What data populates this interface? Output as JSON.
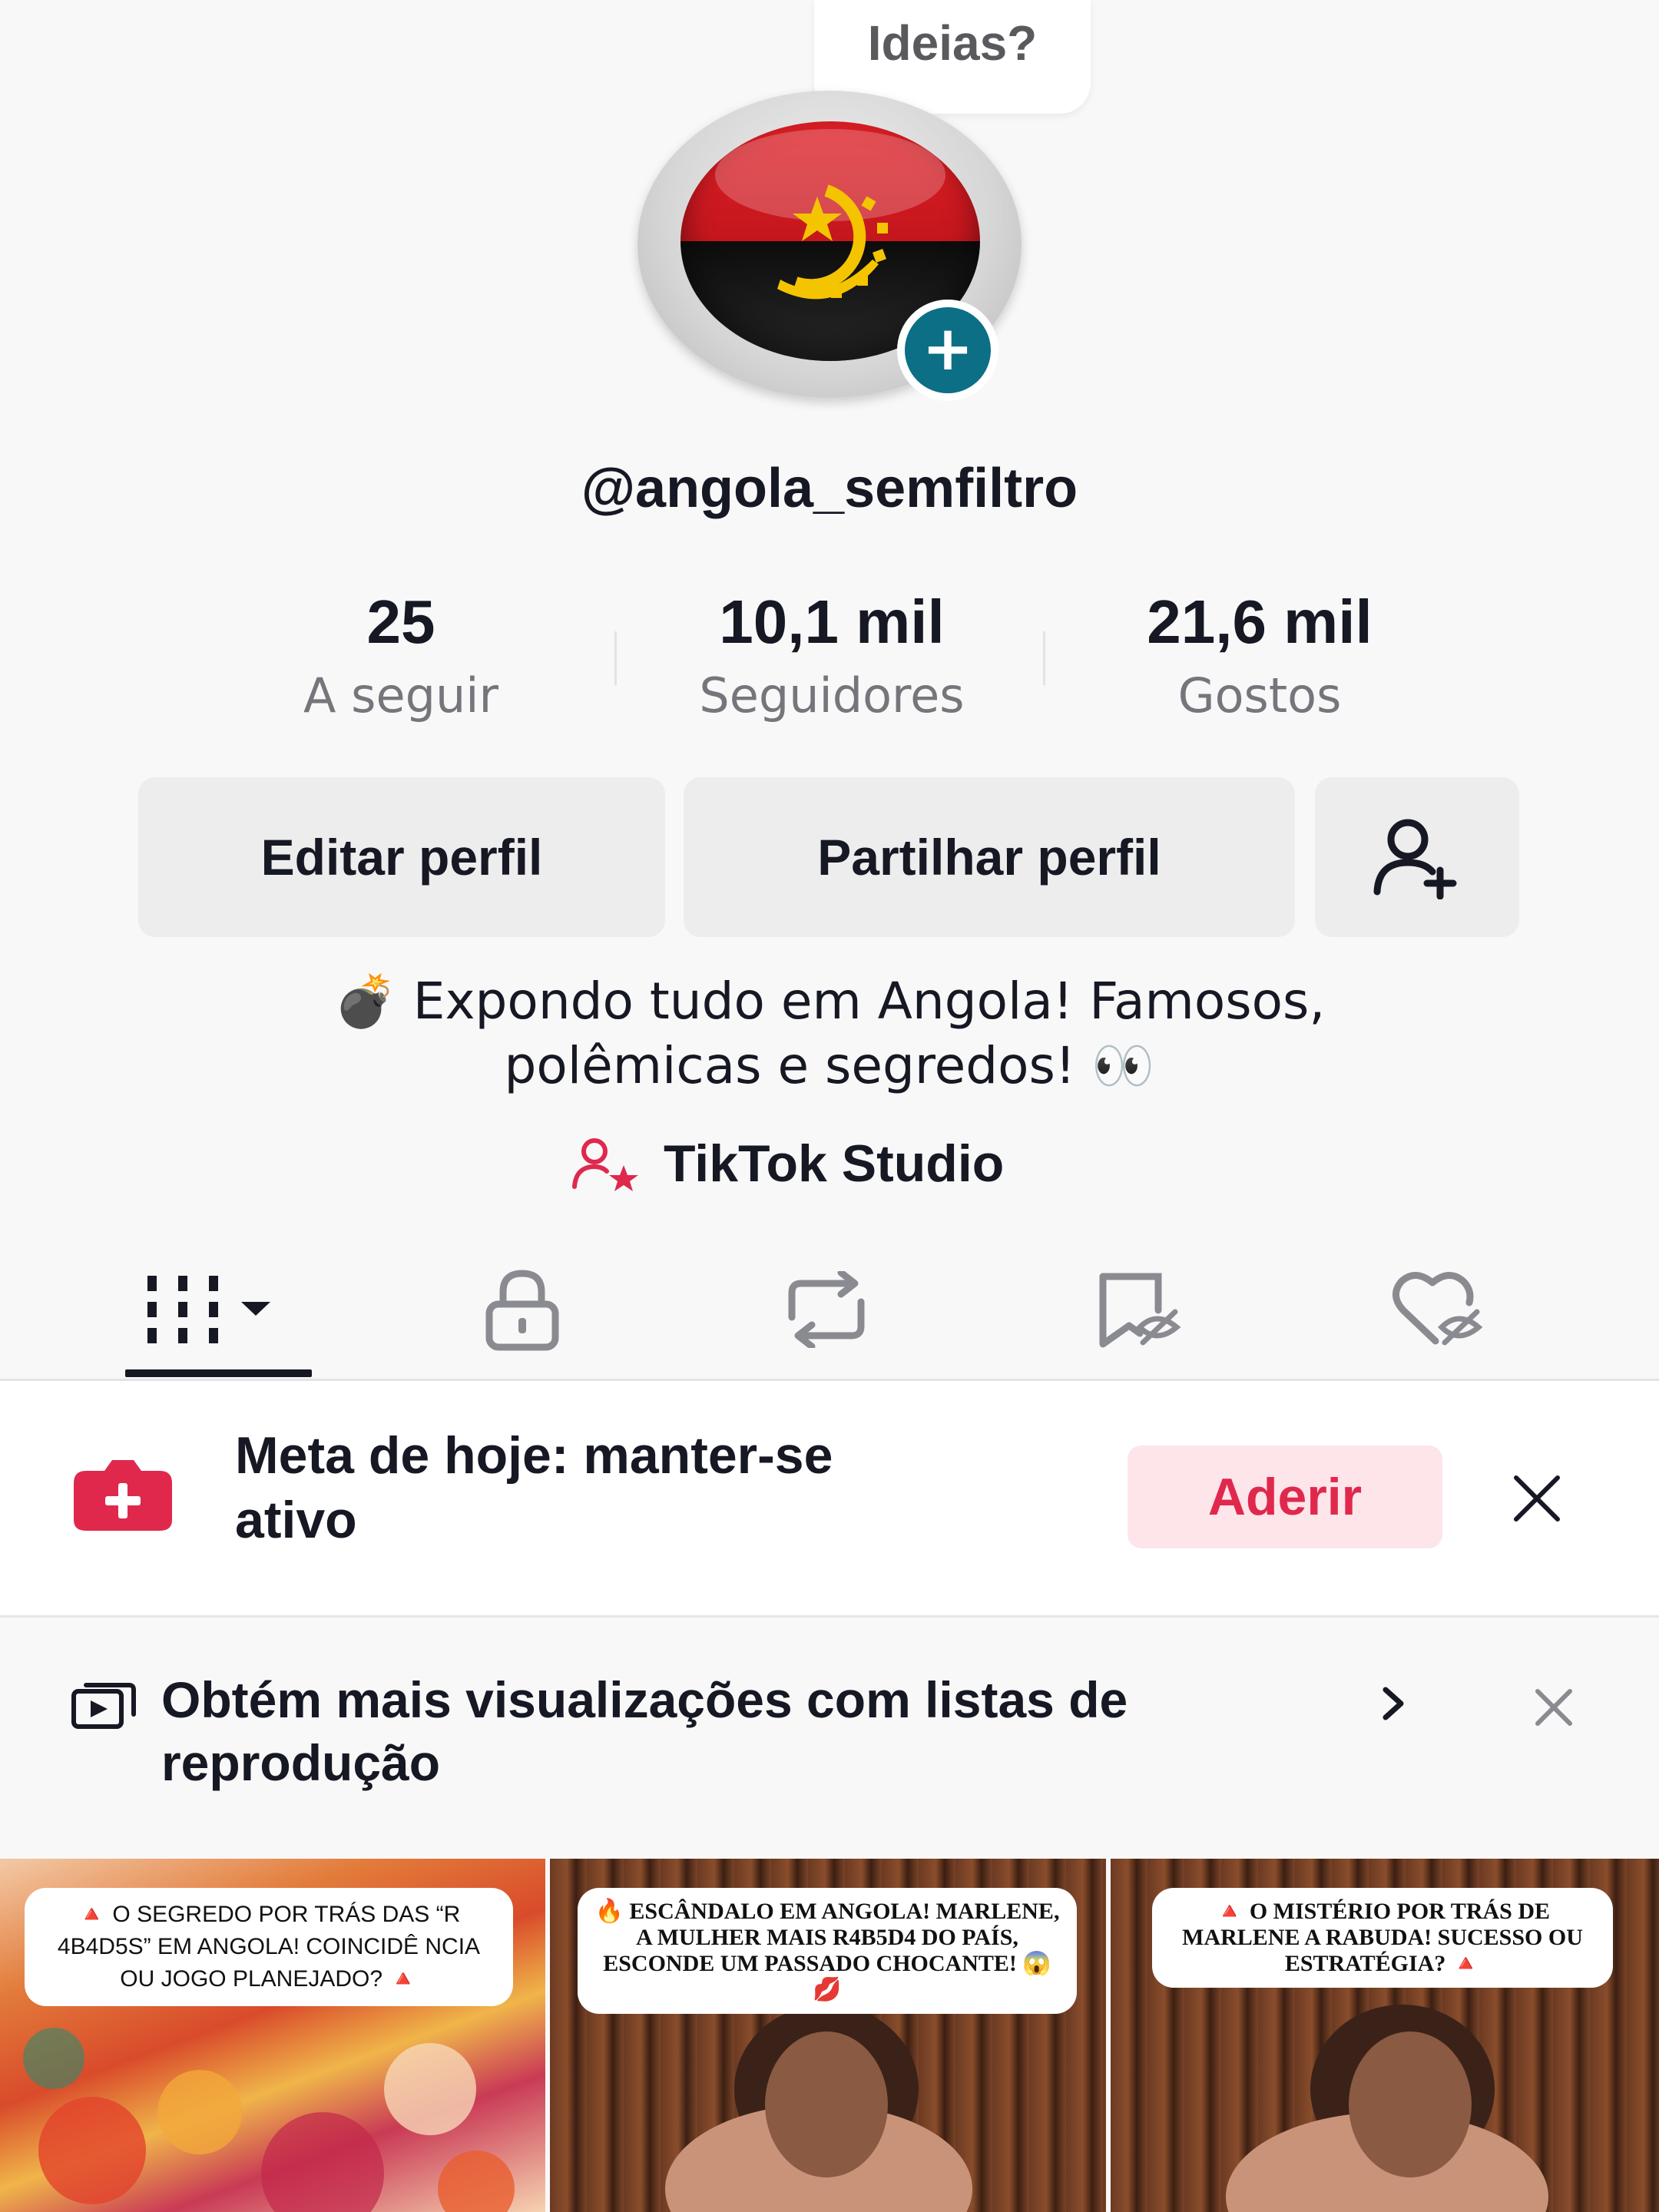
{
  "profile": {
    "ideas_bubble": "Ideias?",
    "username": "@angola_semfiltro",
    "bio_line1": "💣 Expondo tudo em Angola! Famosos,",
    "bio_line2": "polêmicas e segredos! 👀"
  },
  "stats": [
    {
      "value": "25",
      "label": "A seguir"
    },
    {
      "value": "10,1 mil",
      "label": "Seguidores"
    },
    {
      "value": "21,6 mil",
      "label": "Gostos"
    }
  ],
  "buttons": {
    "edit": "Editar perfil",
    "share": "Partilhar perfil"
  },
  "studio": {
    "label": "TikTok Studio"
  },
  "tabs": [
    {
      "icon": "videos-grid-icon",
      "active": true
    },
    {
      "icon": "lock-icon"
    },
    {
      "icon": "repost-icon"
    },
    {
      "icon": "favorites-hidden-icon"
    },
    {
      "icon": "liked-hidden-icon"
    }
  ],
  "goal": {
    "text_line1": "Meta de hoje: manter-se",
    "text_line2": "ativo",
    "join": "Aderir"
  },
  "playlist": {
    "text_line1": "Obtém mais visualizações com listas de",
    "text_line2": "reprodução"
  },
  "videos": [
    {
      "caption": "🔺 O SEGREDO POR TRÁS DAS “R 4B4D5S” EM ANGOLA! COINCIDÊ NCIA OU JOGO PLANEJADO? 🔺"
    },
    {
      "caption": "🔥 ESCÂNDALO EM ANGOLA! MARLENE, A MULHER MAIS R4B5D4 DO PAÍS, ESCONDE UM PASSADO CHOCANTE! 😱💋"
    },
    {
      "caption": "🔺 O MISTÉRIO POR TRÁS DE MARLENE A RABUDA! SUCESSO OU ESTRATÉGIA? 🔺"
    }
  ],
  "colors": {
    "accent": "#e0284d",
    "avatar_plus": "#0c6f86",
    "text": "#161823",
    "muted": "#75757c"
  }
}
